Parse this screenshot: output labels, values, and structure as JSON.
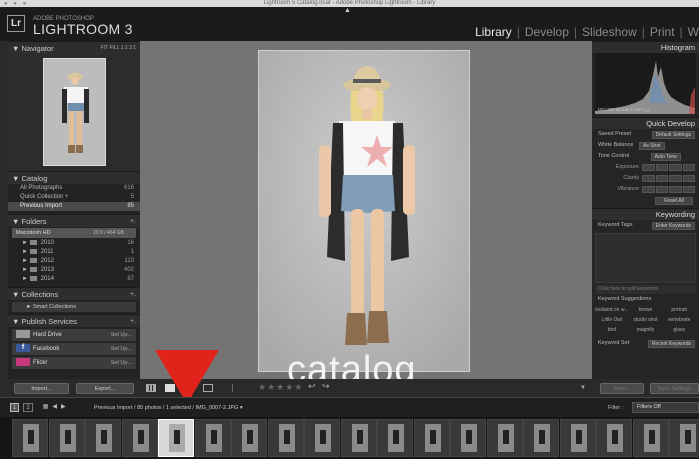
{
  "window": {
    "title": "Lightroom 5 Catalog.lrcat - Adobe Photoshop Lightroom - Library"
  },
  "brand": {
    "small": "ADOBE PHOTOSHOP",
    "big": "LIGHTROOM 3",
    "badge": "Lr"
  },
  "modules": [
    {
      "label": "Library",
      "active": true
    },
    {
      "label": "Develop",
      "active": false
    },
    {
      "label": "Slideshow",
      "active": false
    },
    {
      "label": "Print",
      "active": false
    },
    {
      "label": "W",
      "active": false
    }
  ],
  "navigator": {
    "title": "Navigator",
    "options": "FIT  FILL  1:1  3:1"
  },
  "catalog": {
    "title": "Catalog",
    "items": [
      {
        "label": "All Photographs",
        "count": "616"
      },
      {
        "label": "Quick Collection +",
        "count": "5"
      },
      {
        "label": "Previous Import",
        "count": "85"
      }
    ]
  },
  "folders": {
    "title": "Folders",
    "add": "+.",
    "volume": {
      "label": "Macintosh HD",
      "size": "20.9 / 464 GB"
    },
    "items": [
      {
        "label": "2010",
        "count": "16"
      },
      {
        "label": "2011",
        "count": "1"
      },
      {
        "label": "2012",
        "count": "110"
      },
      {
        "label": "2013",
        "count": "402"
      },
      {
        "label": "2014",
        "count": "87"
      }
    ]
  },
  "collections": {
    "title": "Collections",
    "add": "+.",
    "items": [
      {
        "label": "Smart Collections"
      }
    ]
  },
  "publish": {
    "title": "Publish Services",
    "add": "+.",
    "items": [
      {
        "label": "Hard Drive",
        "action": "Set Up..."
      },
      {
        "label": "Facebook",
        "action": "Set Up..."
      },
      {
        "label": "Flickr",
        "action": "Set Up..."
      }
    ]
  },
  "overlay": {
    "text": "catalog"
  },
  "bottom_buttons": {
    "import": "Import...",
    "export": "Export..."
  },
  "toolbar": {
    "stars": "★★★★★"
  },
  "histogram": {
    "title": "Histogram",
    "info": "ISO 200   35 mm   f / 16   ¹⁄₁₂₅"
  },
  "quick_develop": {
    "title": "Quick Develop",
    "saved_preset_label": "Saved Preset",
    "saved_preset_value": "Default Settings",
    "white_balance_label": "White Balance",
    "white_balance_value": "As Shot",
    "tone_control_label": "Tone Control",
    "tone_control_value": "Auto Tone",
    "exposure": "Exposure",
    "clarity": "Clarity",
    "vibrance": "Vibrance",
    "reset": "Reset All"
  },
  "keywording": {
    "title": "Keywording",
    "tags_label": "Keyword Tags",
    "tags_value": "Enter Keywords",
    "add_placeholder": "Click here to add keywords",
    "suggestions_label": "Keyword Suggestions",
    "suggestions": [
      "isolated on w...",
      "brown",
      "portrait",
      "Little Owl",
      "studio shot",
      "vertebrate",
      "bird",
      "magnify",
      "glass"
    ],
    "set_label": "Keyword Set",
    "set_value": "Recent Keywords"
  },
  "right_bottom": {
    "sync": "Sync...",
    "sync_settings": "Sync Settings"
  },
  "filmstrip": {
    "breadcrumb": "Previous Import / 85 photos / 1 selected / IMG_0007-2.JPG ▾",
    "filter_label": "Filter :",
    "filter_value": "Filters Off",
    "page_one": "1",
    "page_two": "2",
    "selected_index": 4,
    "thumb_count": 19
  },
  "colors": {
    "accent": "#d8d8d8",
    "arrow": "#e0241b",
    "header": "#1b1b1b"
  }
}
